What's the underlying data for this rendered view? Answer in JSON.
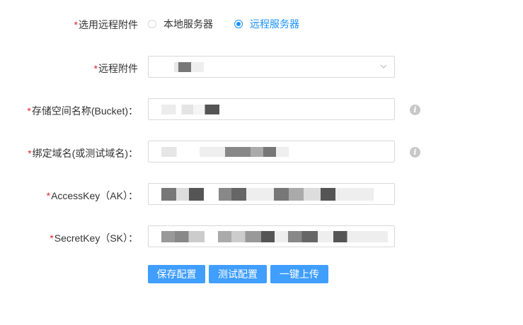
{
  "form": {
    "attachment_type": {
      "required_mark": "*",
      "label": "选用远程附件",
      "options": [
        "本地服务器",
        "远程服务器"
      ],
      "selected": "远程服务器"
    },
    "remote_attachment": {
      "required_mark": "*",
      "label": "远程附件",
      "value": ""
    },
    "bucket": {
      "required_mark": "*",
      "label": "存储空间名称(Bucket)：",
      "value": ""
    },
    "domain": {
      "required_mark": "*",
      "label": "绑定域名(或测试域名)：",
      "value": ""
    },
    "access_key": {
      "required_mark": "*",
      "label": "AccessKey（AK）：",
      "value": ""
    },
    "secret_key": {
      "required_mark": "*",
      "label": "SecretKey（SK）：",
      "value": ""
    },
    "info_icon_glyph": "i"
  },
  "buttons": {
    "save_label": "保存配置",
    "test_label": "测试配置",
    "upload_label": "一键上传"
  },
  "colors": {
    "accent": "#1890ff",
    "button": "#409eff",
    "required": "#e0242a"
  },
  "icons": {
    "info": "info-icon",
    "dropdown": "chevron-down-icon"
  }
}
